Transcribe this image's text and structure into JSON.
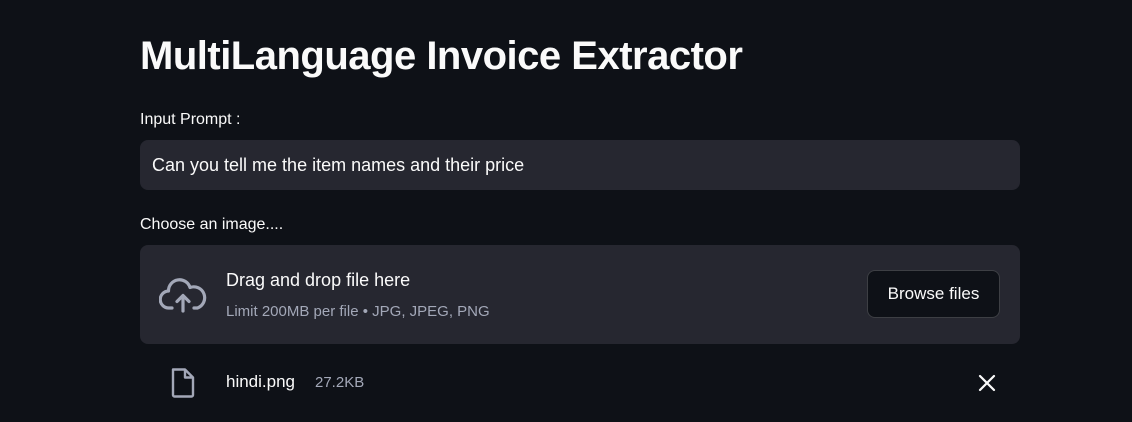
{
  "page": {
    "title": "MultiLanguage Invoice Extractor"
  },
  "prompt": {
    "label": "Input Prompt :",
    "value": "Can you tell me the item names and their price"
  },
  "uploader": {
    "label": "Choose an image....",
    "instructions": "Drag and drop file here",
    "limit": "Limit 200MB per file • JPG, JPEG, PNG",
    "browse_label": "Browse files",
    "icon": "cloud-upload-icon"
  },
  "uploaded_file": {
    "name": "hindi.png",
    "size": "27.2KB",
    "icon": "file-icon",
    "remove_icon": "close-icon"
  },
  "colors": {
    "background": "#0e1117",
    "surface": "#262730",
    "text": "#fafafa",
    "muted_text": "#a3a8b8"
  }
}
